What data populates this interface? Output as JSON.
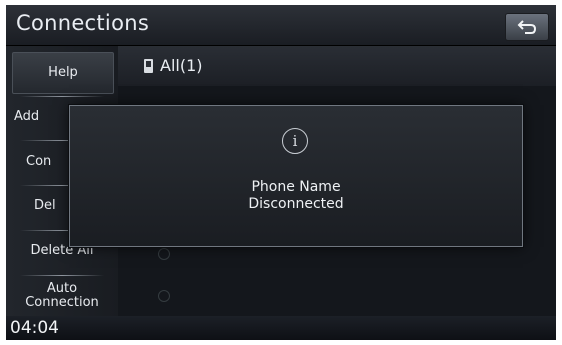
{
  "header": {
    "title": "Connections",
    "back_icon": "back-arrow-icon"
  },
  "sidebar": {
    "items": [
      {
        "label": "Help"
      },
      {
        "label": "Add"
      },
      {
        "label": "Con"
      },
      {
        "label": "Del"
      },
      {
        "label": "Delete All"
      },
      {
        "label": "Auto Connection"
      }
    ]
  },
  "main": {
    "list_header": {
      "label": "All(1)",
      "icon": "phone-icon"
    }
  },
  "popup": {
    "icon": "info-icon",
    "line1": "Phone Name",
    "line2": "Disconnected"
  },
  "status": {
    "time": "04:04"
  },
  "colors": {
    "background": "#0f1217",
    "text": "#e9edf2",
    "popup_border": "#707780"
  }
}
